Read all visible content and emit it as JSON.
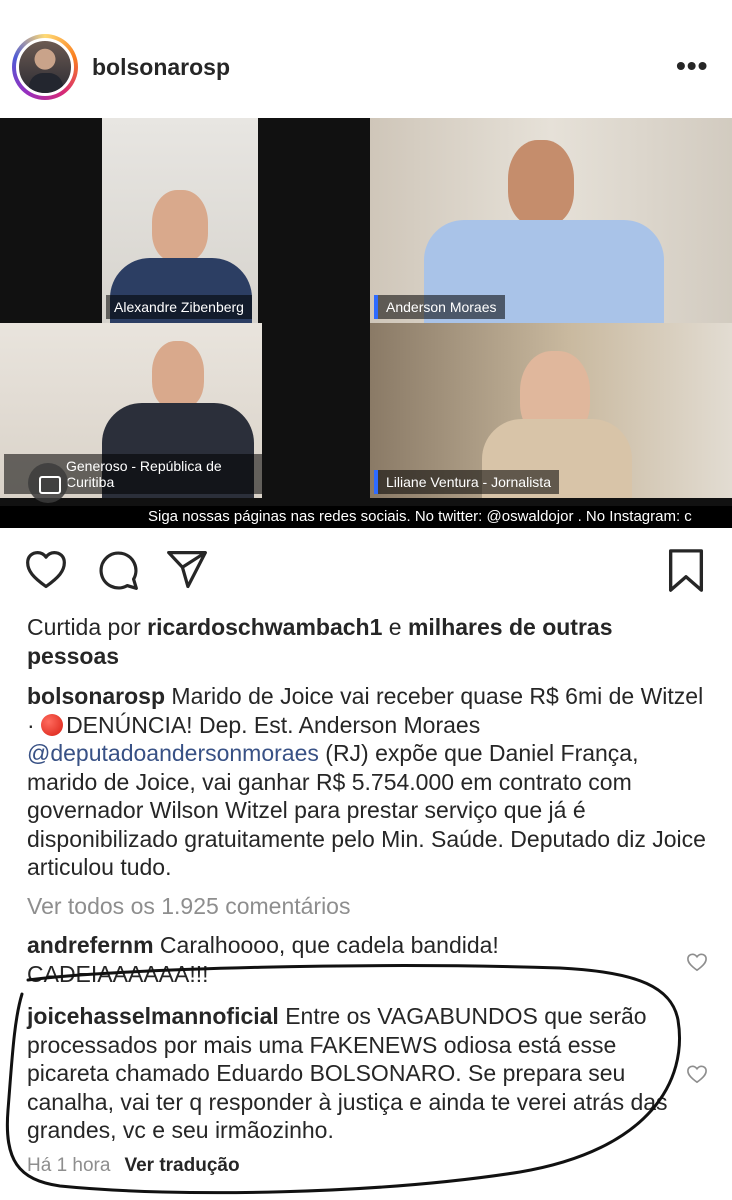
{
  "header": {
    "username": "bolsonarosp",
    "more_label": "•••"
  },
  "video": {
    "tiles": [
      {
        "name": "Alexandre Zibenberg"
      },
      {
        "name": "Anderson Moraes"
      },
      {
        "name": "Generoso - República de Curitiba"
      },
      {
        "name": "Liliane Ventura - Jornalista"
      }
    ],
    "ticker": "Siga nossas páginas nas redes sociais. No twitter: @oswaldojor . No Instagram: c"
  },
  "actions": {
    "icons": [
      "heart-icon",
      "comment-icon",
      "share-icon",
      "bookmark-icon"
    ]
  },
  "likes": {
    "prefix": "Curtida por ",
    "user": "ricardoschwambach1",
    "middle": " e ",
    "suffix": "milhares de outras pessoas"
  },
  "caption": {
    "user": "bolsonarosp",
    "part1": " Marido de Joice vai receber quase R$ 6mi de Witzel · ",
    "part2": "DENÚNCIA! Dep. Est. Anderson Moraes ",
    "mention": "@deputadoandersonmoraes",
    "part3": " (RJ) expõe que Daniel França, marido de Joice, vai ganhar R$ 5.754.000 em contrato com governador Wilson Witzel para prestar serviço que já é disponibilizado gratuitamente pelo Min. Saúde. Deputado diz Joice articulou tudo."
  },
  "view_all_comments": "Ver todos os 1.925 comentários",
  "comments": [
    {
      "user": "andrefernm",
      "text": " Caralhoooo, que cadela bandida! CADEIAAAAAA!!!"
    },
    {
      "user": "joicehasselmannoficial",
      "text": " Entre os VAGABUNDOS que serão processados por mais uma FAKENEWS odiosa está esse picareta chamado Eduardo BOLSONARO. Se prepara seu canalha, vai ter q responder à justiça e ainda te verei atrás das grandes, vc e seu irmãozinho."
    }
  ],
  "comment_meta": {
    "time": "Há 1 hora",
    "translate": "Ver tradução"
  },
  "colors": {
    "text": "#262626",
    "secondary": "#8e8e8e",
    "link": "#385185",
    "annotation_ink": "#111111"
  }
}
